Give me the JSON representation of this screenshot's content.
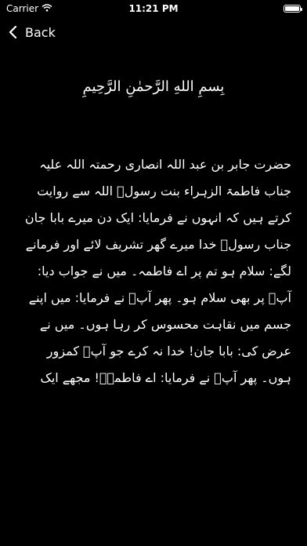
{
  "status_bar": {
    "carrier": "Carrier",
    "time": "11:21 PM",
    "battery_level": 1.0
  },
  "nav": {
    "back_label": "Back"
  },
  "content": {
    "bismillah": "بِسمِ اللهِ الرَّحمٰنِ الرَّحِيمِ",
    "body": "حضرت جابر بن عبد اللہ انصاری رحمتہ اللہ علیہ جناب فاطمۃ الزہراء بنت رسولؐ اللہ سے روایت کرتے ہیں کہ انہوں نے فرمایا: ایک دن میرے بابا جان جناب رسولؐ خدا میرے گھر تشریف لائے اور فرمانے لگے: سلام ہو تم پر اے فاطمہ۔ میں نے جواب دیا: آپؐ پر بھی سلام ہو۔ پھر آپؐ نے فرمایا: میں اپنے جسم میں نقاہت محسوس کر رہا ہوں۔ میں نے عرض کی: بابا جان! خدا نہ کرے جو آپؐ کمزور ہوں۔ پھر آپؐ نے فرمایا: اے فاطمہؑ! مجھے ایک"
  }
}
